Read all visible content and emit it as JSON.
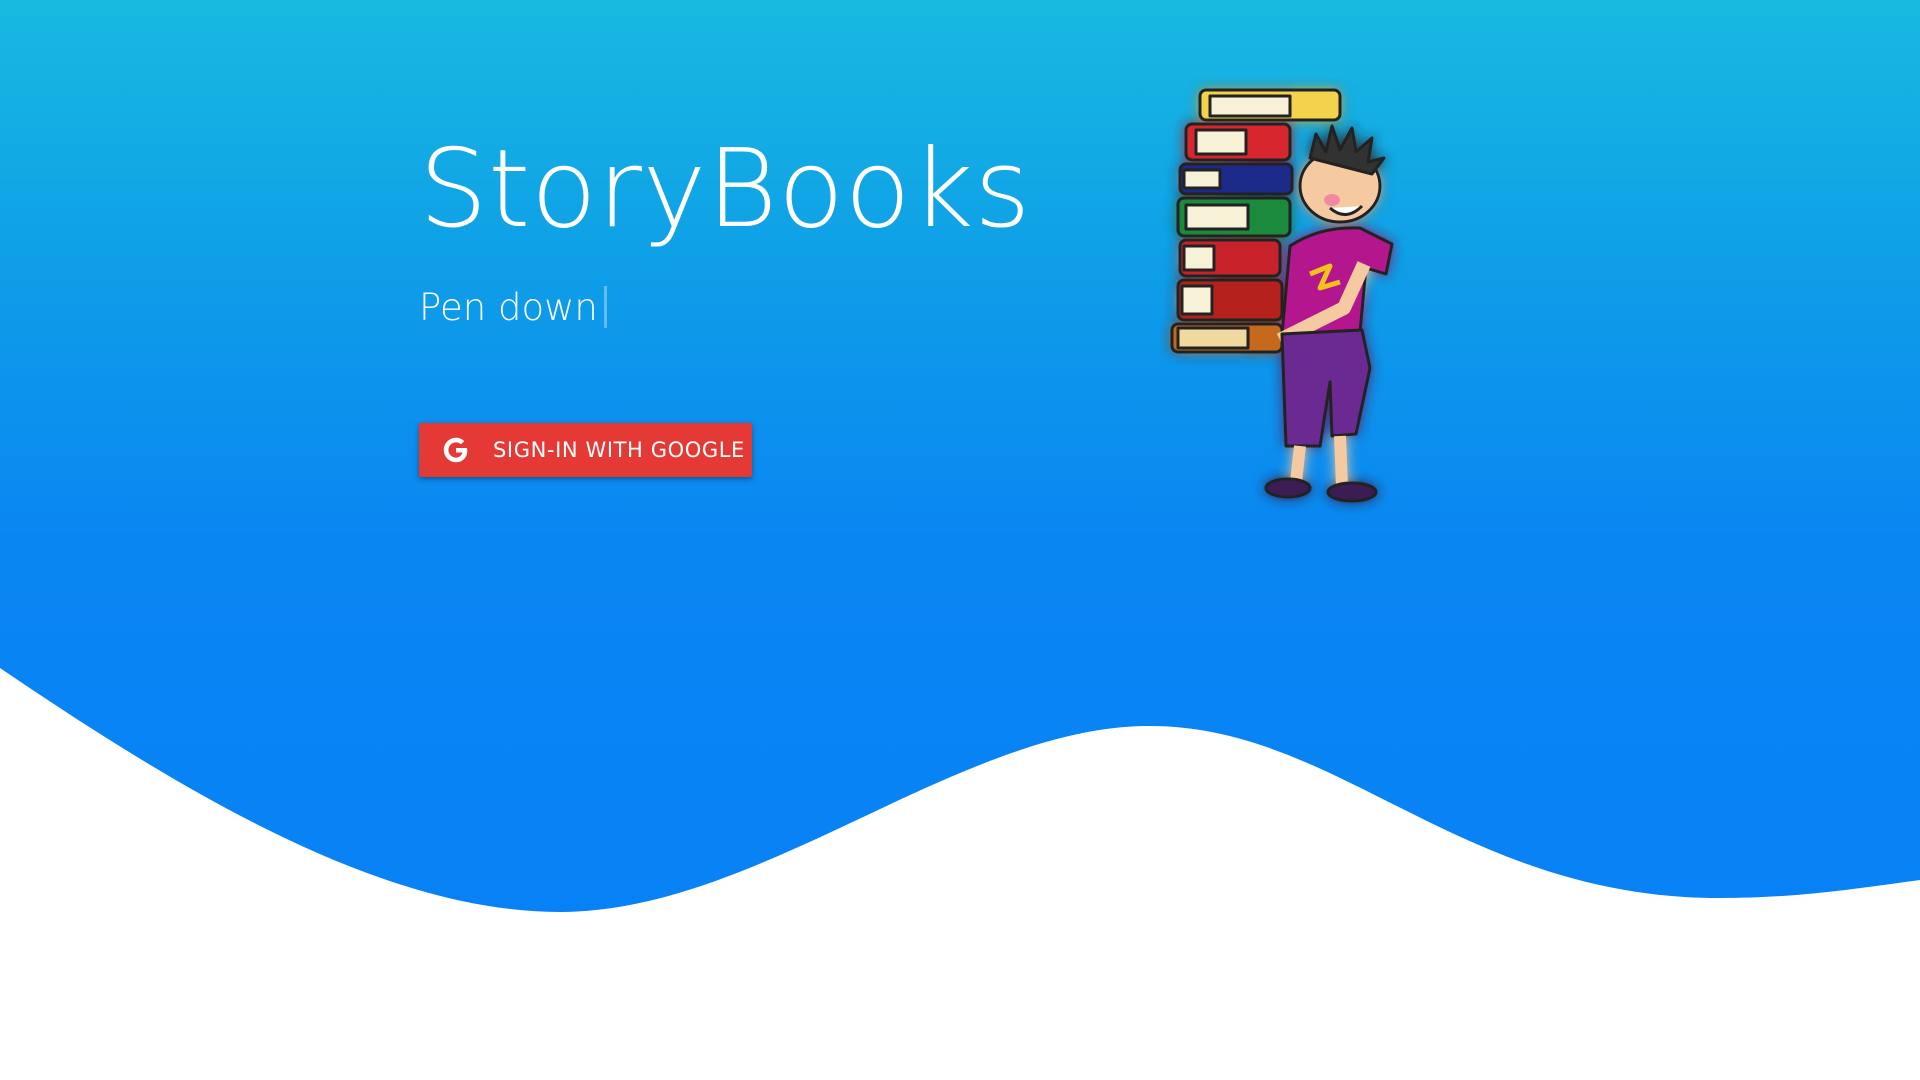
{
  "hero": {
    "title": "StoryBooks",
    "subtitle": "Pen down",
    "signin_label": "SIGN-IN WITH GOOGLE"
  },
  "icons": {
    "google": "google-g-icon",
    "illustration": "boy-carrying-books-illustration"
  },
  "colors": {
    "gradient_top": "#18bae0",
    "gradient_bottom": "#067ff7",
    "button": "#e53935",
    "background": "#ffffff"
  }
}
